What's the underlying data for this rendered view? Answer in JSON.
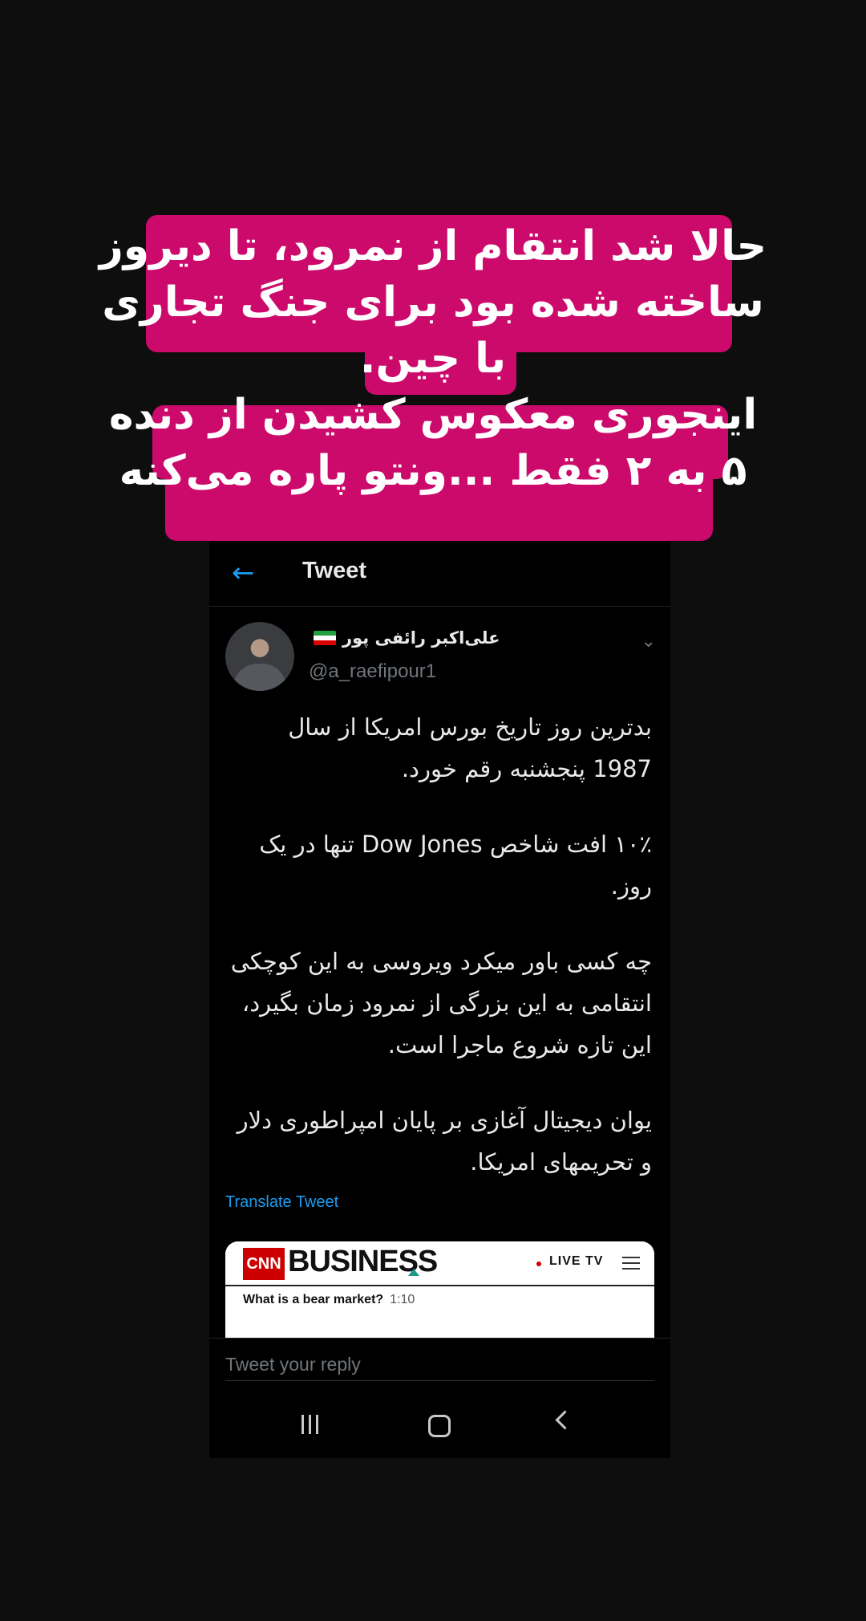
{
  "caption": {
    "lines": [
      "حالا شد انتقام از نمرود، تا دیروز",
      "ساخته شده بود برای جنگ تجاری",
      "با چین.",
      "اینجوری معکوس کشیدن از دنده",
      "۵ به ۲ فقط ...ونتو پاره می‌کنه"
    ],
    "background_color": "#cc0a6c"
  },
  "header": {
    "back_icon": "arrow-left-icon",
    "title": "Tweet"
  },
  "tweet": {
    "author_name": "علی‌اکبر رائفی پور",
    "flag_icon": "iran-flag-icon",
    "handle": "@a_raefipour1",
    "paragraphs": [
      "بدترین روز تاریخ بورس امریکا از سال 1987 پنجشنبه رقم خورد.",
      "۱۰٪ افت شاخص Dow Jones تنها در یک روز.",
      "چه کسی باور میکرد ویروسی به این کوچکی انتقامی به این بزرگی از نمرود زمان بگیرد، این تازه شروع ماجرا است.",
      "یوان دیجیتال آغازی بر پایان امپراطوری دلار و تحریمهای امریکا."
    ],
    "translate_label": "Translate Tweet"
  },
  "media_card": {
    "logo_text": "CNN",
    "brand_text": "BUSINESS",
    "live_label": "LIVE TV",
    "video_title": "What is a bear market?",
    "video_duration": "1:10"
  },
  "reply": {
    "placeholder": "Tweet your reply"
  },
  "system_nav": {
    "recent_icon": "recent-apps-icon",
    "home_icon": "home-icon",
    "back_icon": "back-chevron-icon"
  }
}
